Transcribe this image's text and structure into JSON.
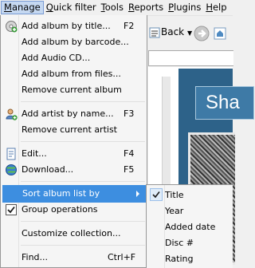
{
  "menubar": {
    "items": [
      {
        "label": "Manage"
      },
      {
        "label": "Quick filter"
      },
      {
        "label": "Tools"
      },
      {
        "label": "Reports"
      },
      {
        "label": "Plugins"
      },
      {
        "label": "Help"
      }
    ]
  },
  "toolbar": {
    "back_label": "Back"
  },
  "background": {
    "title_fragment": "Sha"
  },
  "manage_menu": {
    "items": [
      {
        "label": "Add album by title...",
        "shortcut": "F2",
        "icon": "add-album-icon"
      },
      {
        "label": "Add album by barcode...",
        "shortcut": ""
      },
      {
        "label": "Add Audio CD...",
        "shortcut": ""
      },
      {
        "label": "Add album from files...",
        "shortcut": ""
      },
      {
        "label": "Remove current album",
        "shortcut": ""
      },
      {
        "label": "Add artist by name...",
        "shortcut": "F3",
        "icon": "add-artist-icon"
      },
      {
        "label": "Remove current artist",
        "shortcut": ""
      },
      {
        "label": "Edit...",
        "shortcut": "F4",
        "icon": "edit-icon"
      },
      {
        "label": "Download...",
        "shortcut": "F5",
        "icon": "download-globe-icon"
      },
      {
        "label": "Sort album list by",
        "shortcut": "",
        "submenu": true
      },
      {
        "label": "Group operations",
        "shortcut": "",
        "checked": true
      },
      {
        "label": "Customize collection...",
        "shortcut": ""
      },
      {
        "label": "Find...",
        "shortcut": "Ctrl+F"
      }
    ]
  },
  "sort_submenu": {
    "items": [
      {
        "label": "Title",
        "checked": true
      },
      {
        "label": "Year"
      },
      {
        "label": "Added date"
      },
      {
        "label": "Disc #"
      },
      {
        "label": "Rating"
      }
    ]
  },
  "colors": {
    "highlight": "#3d8ee0",
    "menu_bg": "#f5f5f5",
    "app_panel": "#2d6289"
  }
}
